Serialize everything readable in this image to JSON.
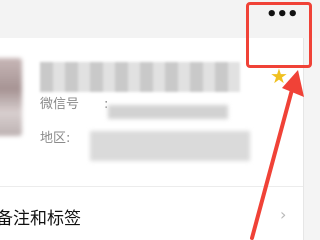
{
  "top_bar": {
    "more_icon_glyph": "•••"
  },
  "profile": {
    "wechat_id_label": "微信号",
    "wechat_id_colon": ":",
    "region_label": "地区:"
  },
  "star_icon": "star-icon",
  "remark_row": {
    "label": "备注和标签",
    "chevron": "›"
  },
  "annotation": {
    "color": "#f04237"
  }
}
